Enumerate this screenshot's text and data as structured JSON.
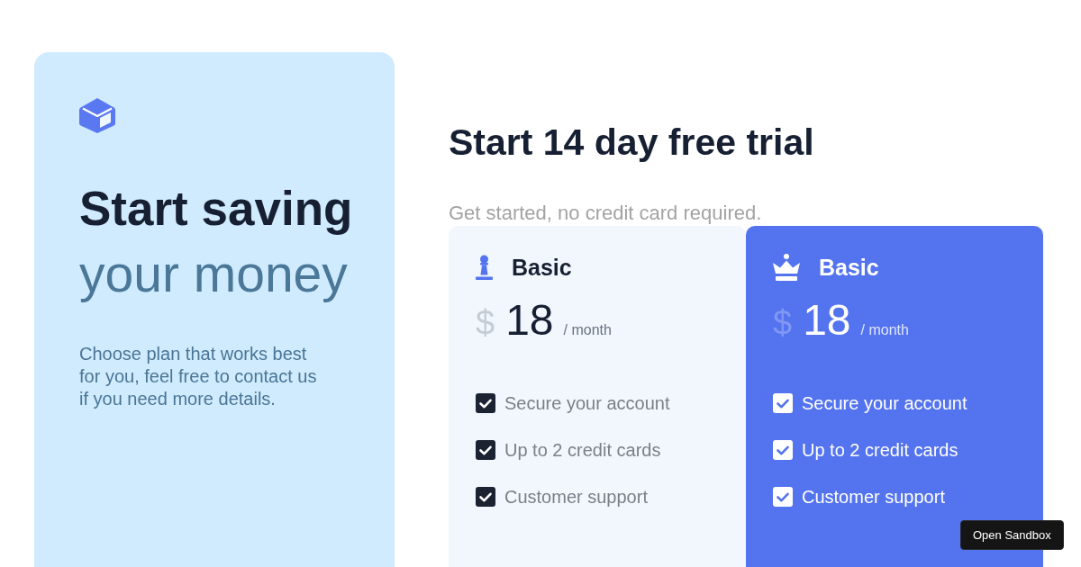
{
  "intro_panel": {
    "title_line_1": "Start saving",
    "title_line_2": "your money",
    "description": "Choose plan that works best for you, feel free to contact us if you need more details."
  },
  "trial": {
    "heading": "Start 14 day free trial",
    "subtitle": "Get started, no credit card required."
  },
  "plans": [
    {
      "kind": "standard",
      "selected": false,
      "name": "Basic",
      "currency": "$",
      "price": "18",
      "period": "/ month",
      "features": [
        {
          "label": "Secure your account",
          "checked": true
        },
        {
          "label": "Up to 2 credit cards",
          "checked": true
        },
        {
          "label": "Customer support",
          "checked": true
        }
      ]
    },
    {
      "kind": "premium",
      "selected": true,
      "name": "Basic",
      "currency": "$",
      "price": "18",
      "period": "/ month",
      "features": [
        {
          "label": "Secure your account",
          "checked": true
        },
        {
          "label": "Up to 2 credit cards",
          "checked": true
        },
        {
          "label": "Customer support",
          "checked": true
        }
      ]
    }
  ],
  "sandbox_button": {
    "label": "Open Sandbox"
  }
}
